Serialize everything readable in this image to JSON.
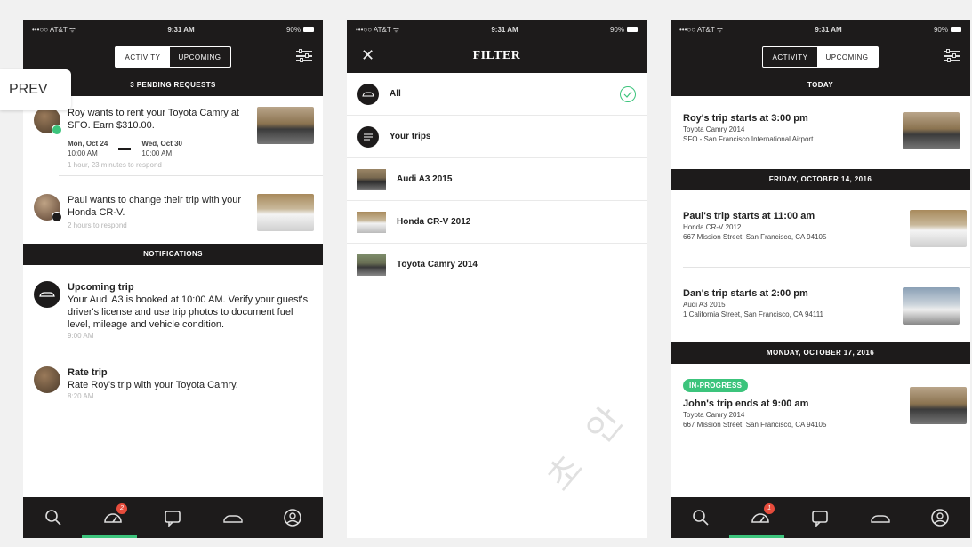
{
  "status": {
    "carrier": "•••○○ AT&T ᯤ",
    "time": "9:31 AM",
    "battery": "90%"
  },
  "nav": {
    "prev_label": "PREV"
  },
  "screen1": {
    "tabs": [
      "ACTIVITY",
      "UPCOMING"
    ],
    "pending_header": "3 PENDING REQUESTS",
    "requests": [
      {
        "text": "Roy wants to rent your Toyota Camry at SFO. Earn $310.00.",
        "start_day": "Mon, Oct 24",
        "start_time": "10:00 AM",
        "end_day": "Wed, Oct 30",
        "end_time": "10:00 AM",
        "note": "1 hour, 23 minutes to respond"
      },
      {
        "text": "Paul wants to change their trip with your Honda CR-V.",
        "note": "2 hours to respond"
      }
    ],
    "notifications_header": "NOTIFICATIONS",
    "notifications": [
      {
        "title": "Upcoming trip",
        "body": "Your Audi A3 is booked at 10:00 AM. Verify your guest's driver's license and use trip photos to document fuel level, mileage and vehicle condition.",
        "time": "9:00 AM"
      },
      {
        "title": "Rate trip",
        "body": "Rate Roy's trip with your Toyota Camry.",
        "time": "8:20 AM"
      }
    ],
    "badge_count": "2"
  },
  "screen2": {
    "title": "FILTER",
    "options": [
      "All",
      "Your trips",
      "Audi A3 2015",
      "Honda CR-V 2012",
      "Toyota Camry 2014"
    ]
  },
  "screen3": {
    "tabs": [
      "ACTIVITY",
      "UPCOMING"
    ],
    "sections": {
      "today": "TODAY",
      "friday": "FRIDAY, OCTOBER 14, 2016",
      "monday": "MONDAY, OCTOBER 17, 2016"
    },
    "trips": [
      {
        "title": "Roy's trip starts at 3:00 pm",
        "car": "Toyota Camry 2014",
        "location": "SFO - San Francisco International Airport"
      },
      {
        "title": "Paul's trip starts at 11:00 am",
        "car": "Honda CR-V 2012",
        "location": "667 Mission Street, San Francisco, CA 94105"
      },
      {
        "title": "Dan's trip starts at 2:00 pm",
        "car": "Audi A3 2015",
        "location": "1 California Street, San Francisco, CA 94111"
      },
      {
        "status": "IN-PROGRESS",
        "title": "John's trip ends at 9:00 am",
        "car": "Toyota Camry 2014",
        "location": "667 Mission Street, San Francisco, CA 94105"
      }
    ],
    "badge_count": "1"
  },
  "watermark": "초 안",
  "colors": {
    "dark": "#1d1b1b",
    "accent": "#3cc47c",
    "badge": "#e74c3c"
  },
  "icons": {
    "bottom_nav": [
      "search-icon",
      "dashboard-icon",
      "chat-icon",
      "car-icon",
      "profile-icon"
    ]
  }
}
